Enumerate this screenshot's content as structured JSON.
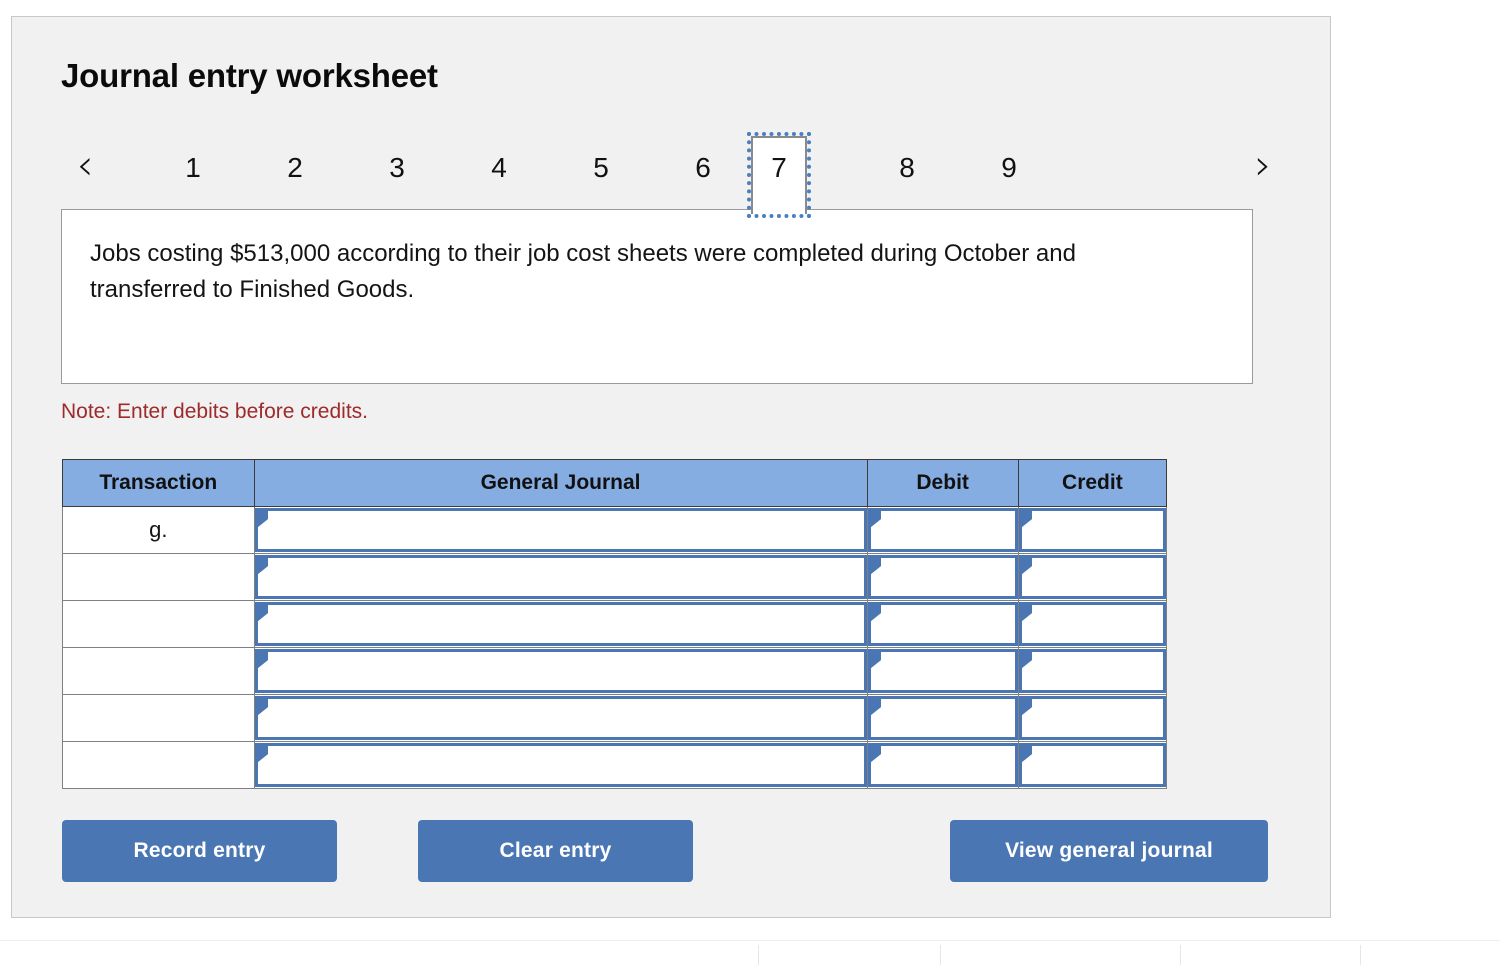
{
  "panel": {
    "title": "Journal entry worksheet"
  },
  "tabs": {
    "prev_icon": "chevron-left-icon",
    "next_icon": "chevron-right-icon",
    "selected": "7",
    "items": [
      {
        "label": "1"
      },
      {
        "label": "2"
      },
      {
        "label": "3"
      },
      {
        "label": "4"
      },
      {
        "label": "5"
      },
      {
        "label": "6"
      },
      {
        "label": "7"
      },
      {
        "label": "8"
      },
      {
        "label": "9"
      }
    ]
  },
  "description": {
    "text": "Jobs costing $513,000 according to their job cost sheets were completed during October and transferred to Finished Goods."
  },
  "note": {
    "text": "Note: Enter debits before credits."
  },
  "table": {
    "headers": {
      "transaction": "Transaction",
      "general_journal": "General Journal",
      "debit": "Debit",
      "credit": "Credit"
    },
    "rows": [
      {
        "transaction": "g.",
        "general_journal": "",
        "debit": "",
        "credit": ""
      },
      {
        "transaction": "",
        "general_journal": "",
        "debit": "",
        "credit": ""
      },
      {
        "transaction": "",
        "general_journal": "",
        "debit": "",
        "credit": ""
      },
      {
        "transaction": "",
        "general_journal": "",
        "debit": "",
        "credit": ""
      },
      {
        "transaction": "",
        "general_journal": "",
        "debit": "",
        "credit": ""
      },
      {
        "transaction": "",
        "general_journal": "",
        "debit": "",
        "credit": ""
      }
    ]
  },
  "buttons": {
    "record": "Record entry",
    "clear": "Clear entry",
    "view": "View general journal"
  },
  "colors": {
    "panel_background": "#f1f1f1",
    "header_blue": "#86ade2",
    "button_blue": "#4a77b4",
    "note_red": "#9e2a2b",
    "input_border_blue": "#4a77b4",
    "selected_tab_outline": "#4a7fc1"
  }
}
